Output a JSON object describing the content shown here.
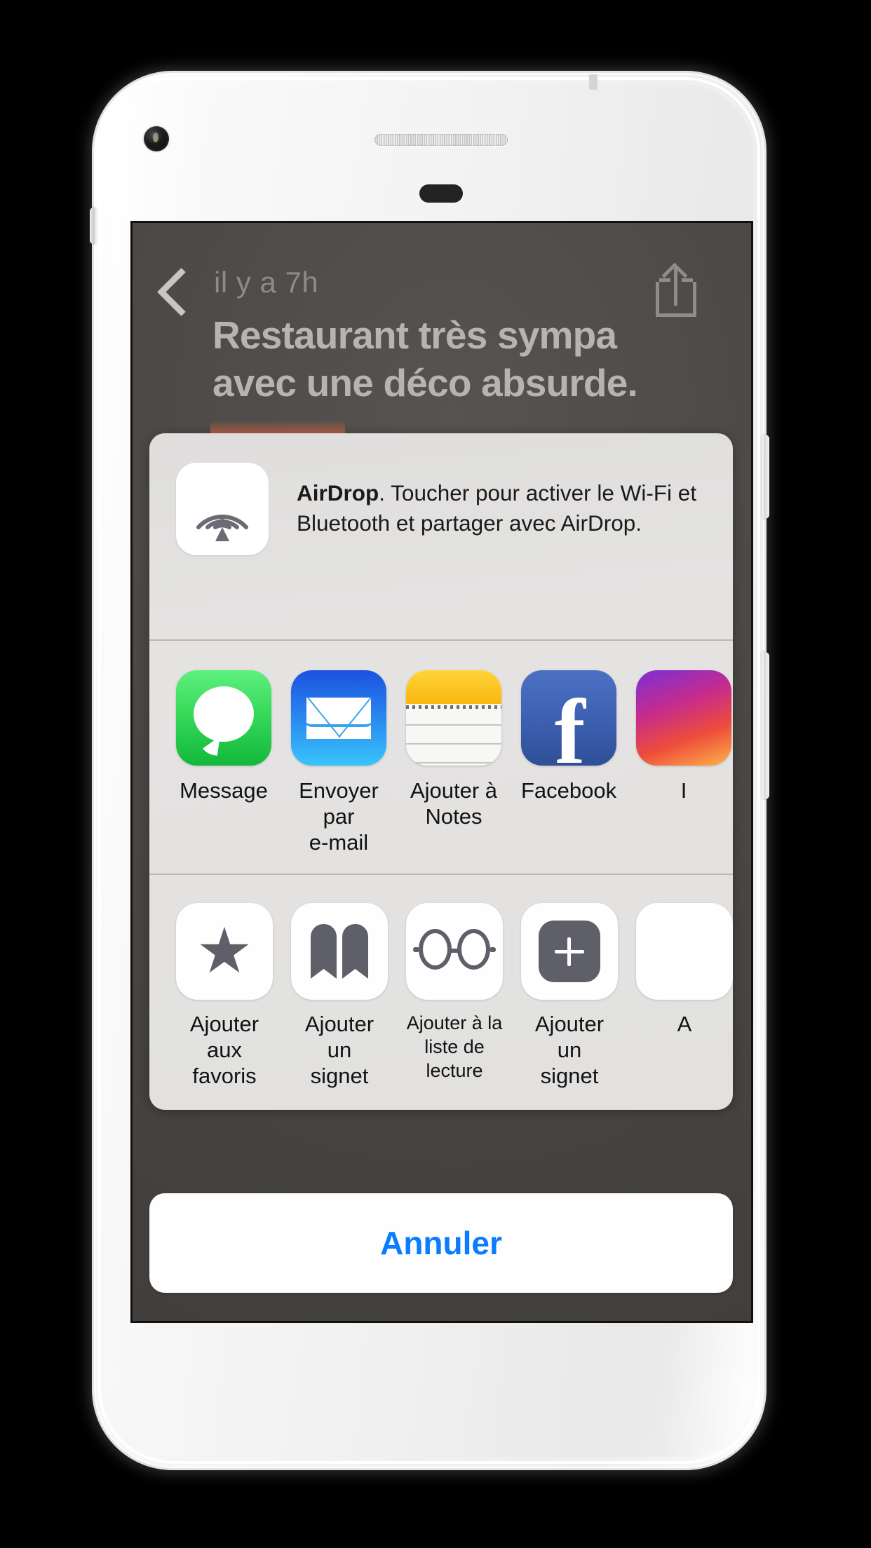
{
  "device": {
    "camera_icon": "front-camera-icon",
    "speaker_icon": "earpiece-speaker-icon",
    "sensor_icon": "proximity-sensor-icon"
  },
  "nav": {
    "back_icon": "chevron-left-icon",
    "timestamp": "il y a 7h",
    "share_icon": "share-icon"
  },
  "article": {
    "title": "Restaurant très sympa avec une déco absurde."
  },
  "share_sheet": {
    "airdrop": {
      "icon": "airdrop-icon",
      "name": "AirDrop",
      "message": ". Toucher pour activer le Wi-Fi et Bluetooth et partager avec AirDrop."
    },
    "apps": [
      {
        "label": "Message",
        "icon": "messages-app-icon"
      },
      {
        "label": "Envoyer par\ne-mail",
        "icon": "mail-app-icon"
      },
      {
        "label": "Ajouter à\nNotes",
        "icon": "notes-app-icon"
      },
      {
        "label": "Facebook",
        "icon": "facebook-app-icon"
      },
      {
        "label": "I",
        "icon": "instagram-app-icon"
      }
    ],
    "actions": [
      {
        "label": "Ajouter\naux favoris",
        "icon": "star-icon",
        "small": false
      },
      {
        "label": "Ajouter un\nsignet",
        "icon": "book-icon",
        "small": false
      },
      {
        "label": "Ajouter à la\nliste de lecture",
        "icon": "glasses-icon",
        "small": true
      },
      {
        "label": "Ajouter un\nsignet",
        "icon": "plus-icon",
        "small": false
      },
      {
        "label": "A",
        "icon": "more-icon",
        "small": false
      }
    ],
    "cancel_label": "Annuler"
  },
  "colors": {
    "accent_blue": "#0a7cff",
    "sheet_bg": "#e2e1e0",
    "screen_bg": "#4a4744",
    "title_text": "#b6b3b0"
  }
}
